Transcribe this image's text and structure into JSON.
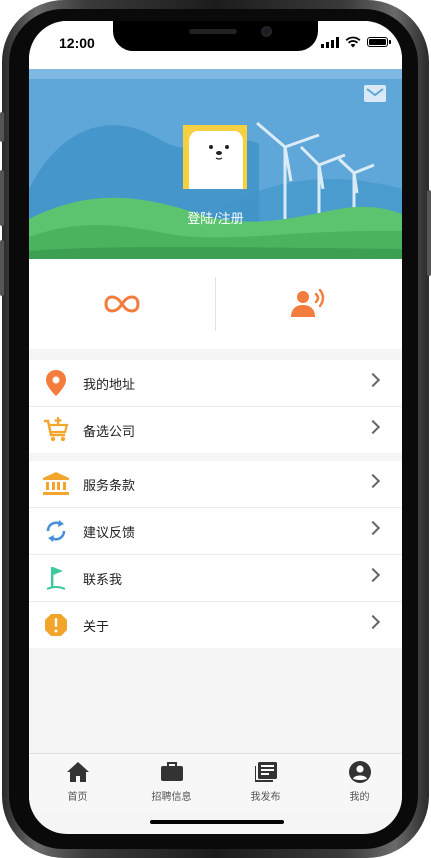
{
  "status_bar": {
    "time": "12:00"
  },
  "profile": {
    "login_label": "登陆/注册"
  },
  "menu_groups": [
    [
      {
        "label": "我的地址",
        "icon": "location-pin-icon",
        "color": "#f47c3c"
      },
      {
        "label": "备选公司",
        "icon": "cart-add-icon",
        "color": "#f2a52a"
      }
    ],
    [
      {
        "label": "服务条款",
        "icon": "bank-icon",
        "color": "#f2a52a"
      },
      {
        "label": "建议反馈",
        "icon": "sync-icon",
        "color": "#4a90d9"
      },
      {
        "label": "联系我",
        "icon": "flag-icon",
        "color": "#3cc9a0"
      },
      {
        "label": "关于",
        "icon": "warning-icon",
        "color": "#f2a52a"
      }
    ]
  ],
  "tabs": [
    {
      "label": "首页",
      "icon": "home-icon"
    },
    {
      "label": "招聘信息",
      "icon": "briefcase-icon"
    },
    {
      "label": "我发布",
      "icon": "newspaper-icon"
    },
    {
      "label": "我的",
      "icon": "user-circle-icon"
    }
  ],
  "colors": {
    "accent": "#f47c3c",
    "banner": "#5ea7d8"
  }
}
